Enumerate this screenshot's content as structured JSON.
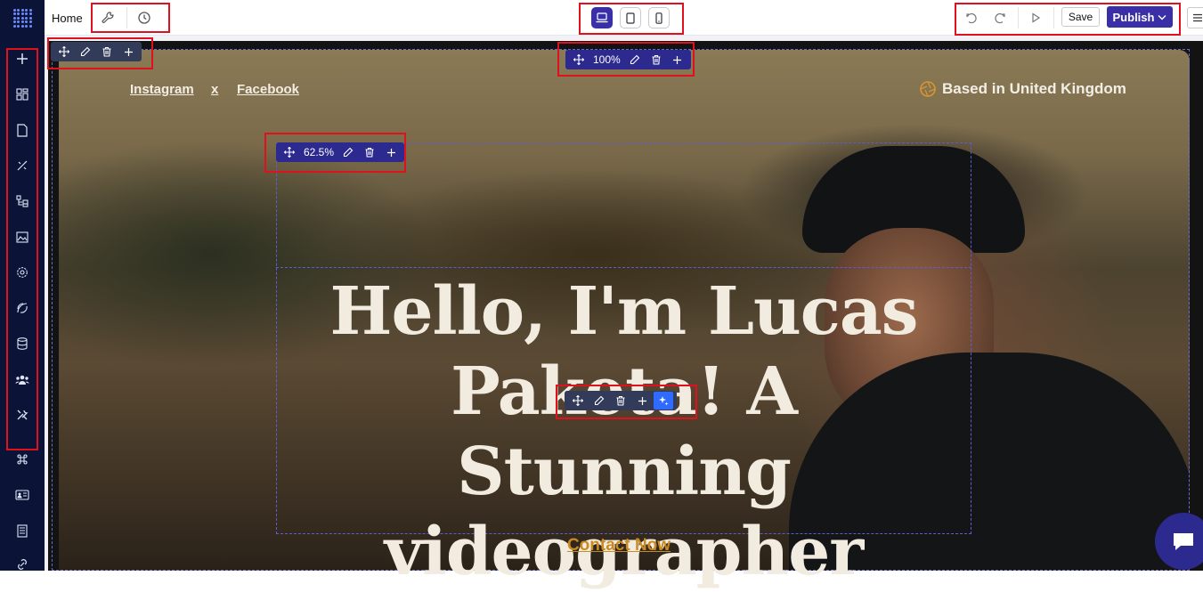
{
  "topbar": {
    "page_label": "Home",
    "settings_icon": "wrench-icon",
    "history_icon": "clock-icon",
    "devices": [
      {
        "name": "desktop",
        "icon": "laptop-icon",
        "active": true
      },
      {
        "name": "tablet",
        "icon": "tablet-icon",
        "active": false
      },
      {
        "name": "mobile",
        "icon": "phone-icon",
        "active": false
      }
    ],
    "undo_icon": "undo-icon",
    "redo_icon": "redo-icon",
    "preview_icon": "play-icon",
    "save_label": "Save",
    "publish_label": "Publish",
    "menu_icon": "hamburger-icon"
  },
  "sidebar": {
    "items": [
      "add-icon",
      "widgets-icon",
      "page-icon",
      "design-icon",
      "layers-icon",
      "image-icon",
      "settings-icon",
      "integrations-icon",
      "database-icon",
      "team-icon",
      "tools-icon",
      "command-icon",
      "contact-card-icon",
      "notes-icon",
      "link-icon"
    ]
  },
  "canvas": {
    "social_left": "Instagram",
    "social_sep": "x",
    "social_right": "Facebook",
    "location": "Based in United Kingdom",
    "heading": "Hello, I'm Lucas Paketa! A Stunning videographer",
    "cta": "Contact Now",
    "section_width": "100%",
    "column_width": "62.5%"
  },
  "colors": {
    "brand": "#3b2fa8",
    "sidebar_bg": "#0b1437",
    "highlight": "#e0111f",
    "cta": "#c98a24"
  }
}
